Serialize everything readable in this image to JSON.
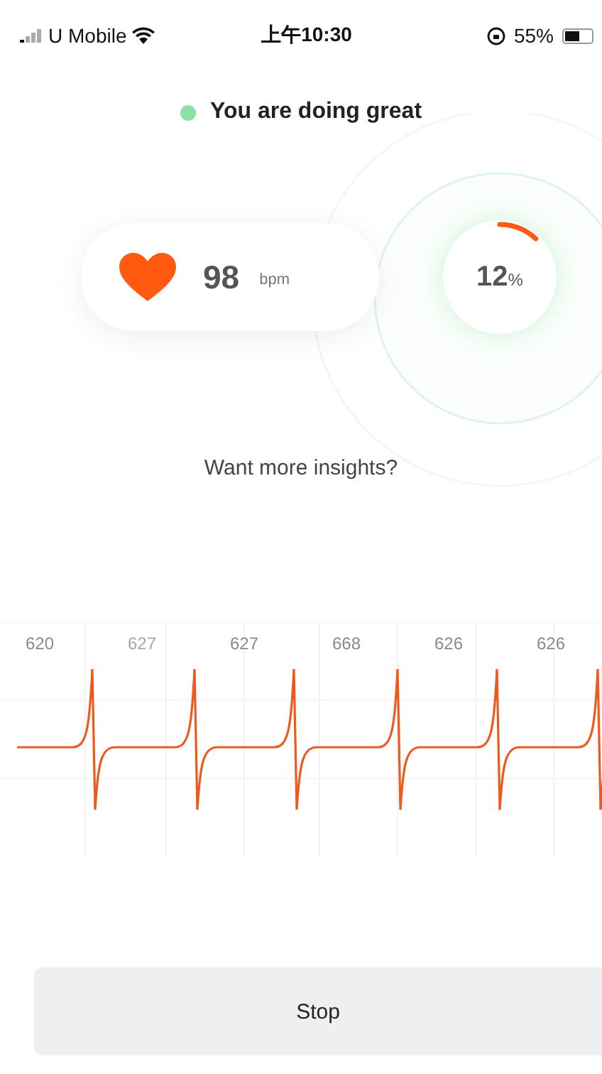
{
  "status_bar": {
    "carrier": "U Mobile",
    "time": "上午10:30",
    "battery": "55%"
  },
  "status": {
    "text": "You are doing great",
    "color": "#8ee0a6"
  },
  "heart_rate": {
    "value": "98",
    "unit": "bpm"
  },
  "progress": {
    "value": "12",
    "unit": "%"
  },
  "insights_link": "Want more insights?",
  "ecg": {
    "intervals": [
      {
        "text": "620",
        "faded": false
      },
      {
        "text": "627",
        "faded": true
      },
      {
        "text": "627",
        "faded": false
      },
      {
        "text": "668",
        "faded": false
      },
      {
        "text": "626",
        "faded": false
      },
      {
        "text": "626",
        "faded": false
      }
    ]
  },
  "stop_button": "Stop"
}
